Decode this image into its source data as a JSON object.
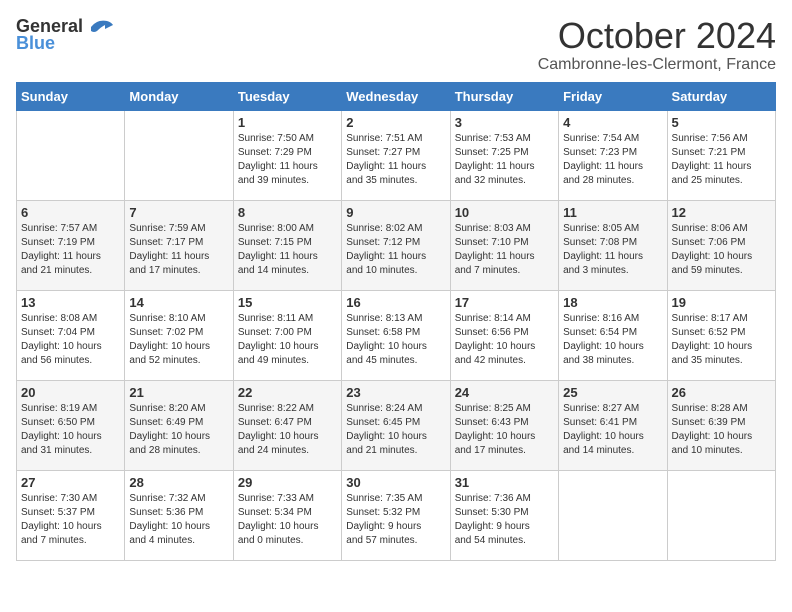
{
  "header": {
    "logo_general": "General",
    "logo_blue": "Blue",
    "month_title": "October 2024",
    "subtitle": "Cambronne-les-Clermont, France"
  },
  "days_of_week": [
    "Sunday",
    "Monday",
    "Tuesday",
    "Wednesday",
    "Thursday",
    "Friday",
    "Saturday"
  ],
  "weeks": [
    [
      {
        "day": "",
        "info": ""
      },
      {
        "day": "",
        "info": ""
      },
      {
        "day": "1",
        "info": "Sunrise: 7:50 AM\nSunset: 7:29 PM\nDaylight: 11 hours\nand 39 minutes."
      },
      {
        "day": "2",
        "info": "Sunrise: 7:51 AM\nSunset: 7:27 PM\nDaylight: 11 hours\nand 35 minutes."
      },
      {
        "day": "3",
        "info": "Sunrise: 7:53 AM\nSunset: 7:25 PM\nDaylight: 11 hours\nand 32 minutes."
      },
      {
        "day": "4",
        "info": "Sunrise: 7:54 AM\nSunset: 7:23 PM\nDaylight: 11 hours\nand 28 minutes."
      },
      {
        "day": "5",
        "info": "Sunrise: 7:56 AM\nSunset: 7:21 PM\nDaylight: 11 hours\nand 25 minutes."
      }
    ],
    [
      {
        "day": "6",
        "info": "Sunrise: 7:57 AM\nSunset: 7:19 PM\nDaylight: 11 hours\nand 21 minutes."
      },
      {
        "day": "7",
        "info": "Sunrise: 7:59 AM\nSunset: 7:17 PM\nDaylight: 11 hours\nand 17 minutes."
      },
      {
        "day": "8",
        "info": "Sunrise: 8:00 AM\nSunset: 7:15 PM\nDaylight: 11 hours\nand 14 minutes."
      },
      {
        "day": "9",
        "info": "Sunrise: 8:02 AM\nSunset: 7:12 PM\nDaylight: 11 hours\nand 10 minutes."
      },
      {
        "day": "10",
        "info": "Sunrise: 8:03 AM\nSunset: 7:10 PM\nDaylight: 11 hours\nand 7 minutes."
      },
      {
        "day": "11",
        "info": "Sunrise: 8:05 AM\nSunset: 7:08 PM\nDaylight: 11 hours\nand 3 minutes."
      },
      {
        "day": "12",
        "info": "Sunrise: 8:06 AM\nSunset: 7:06 PM\nDaylight: 10 hours\nand 59 minutes."
      }
    ],
    [
      {
        "day": "13",
        "info": "Sunrise: 8:08 AM\nSunset: 7:04 PM\nDaylight: 10 hours\nand 56 minutes."
      },
      {
        "day": "14",
        "info": "Sunrise: 8:10 AM\nSunset: 7:02 PM\nDaylight: 10 hours\nand 52 minutes."
      },
      {
        "day": "15",
        "info": "Sunrise: 8:11 AM\nSunset: 7:00 PM\nDaylight: 10 hours\nand 49 minutes."
      },
      {
        "day": "16",
        "info": "Sunrise: 8:13 AM\nSunset: 6:58 PM\nDaylight: 10 hours\nand 45 minutes."
      },
      {
        "day": "17",
        "info": "Sunrise: 8:14 AM\nSunset: 6:56 PM\nDaylight: 10 hours\nand 42 minutes."
      },
      {
        "day": "18",
        "info": "Sunrise: 8:16 AM\nSunset: 6:54 PM\nDaylight: 10 hours\nand 38 minutes."
      },
      {
        "day": "19",
        "info": "Sunrise: 8:17 AM\nSunset: 6:52 PM\nDaylight: 10 hours\nand 35 minutes."
      }
    ],
    [
      {
        "day": "20",
        "info": "Sunrise: 8:19 AM\nSunset: 6:50 PM\nDaylight: 10 hours\nand 31 minutes."
      },
      {
        "day": "21",
        "info": "Sunrise: 8:20 AM\nSunset: 6:49 PM\nDaylight: 10 hours\nand 28 minutes."
      },
      {
        "day": "22",
        "info": "Sunrise: 8:22 AM\nSunset: 6:47 PM\nDaylight: 10 hours\nand 24 minutes."
      },
      {
        "day": "23",
        "info": "Sunrise: 8:24 AM\nSunset: 6:45 PM\nDaylight: 10 hours\nand 21 minutes."
      },
      {
        "day": "24",
        "info": "Sunrise: 8:25 AM\nSunset: 6:43 PM\nDaylight: 10 hours\nand 17 minutes."
      },
      {
        "day": "25",
        "info": "Sunrise: 8:27 AM\nSunset: 6:41 PM\nDaylight: 10 hours\nand 14 minutes."
      },
      {
        "day": "26",
        "info": "Sunrise: 8:28 AM\nSunset: 6:39 PM\nDaylight: 10 hours\nand 10 minutes."
      }
    ],
    [
      {
        "day": "27",
        "info": "Sunrise: 7:30 AM\nSunset: 5:37 PM\nDaylight: 10 hours\nand 7 minutes."
      },
      {
        "day": "28",
        "info": "Sunrise: 7:32 AM\nSunset: 5:36 PM\nDaylight: 10 hours\nand 4 minutes."
      },
      {
        "day": "29",
        "info": "Sunrise: 7:33 AM\nSunset: 5:34 PM\nDaylight: 10 hours\nand 0 minutes."
      },
      {
        "day": "30",
        "info": "Sunrise: 7:35 AM\nSunset: 5:32 PM\nDaylight: 9 hours\nand 57 minutes."
      },
      {
        "day": "31",
        "info": "Sunrise: 7:36 AM\nSunset: 5:30 PM\nDaylight: 9 hours\nand 54 minutes."
      },
      {
        "day": "",
        "info": ""
      },
      {
        "day": "",
        "info": ""
      }
    ]
  ]
}
